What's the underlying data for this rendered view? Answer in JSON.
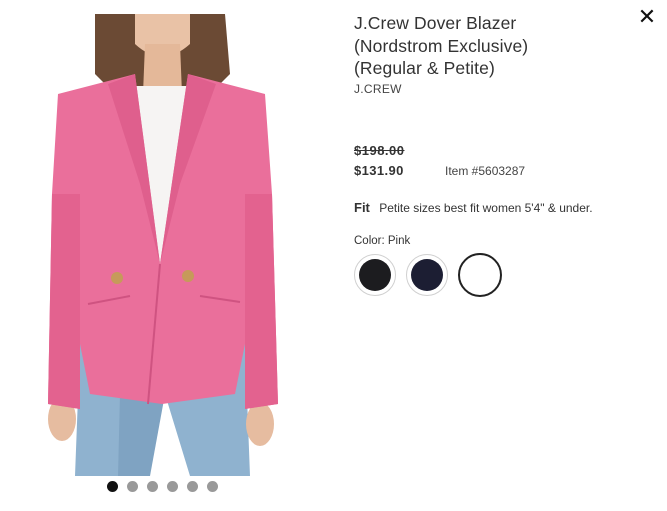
{
  "product": {
    "title_line1": "J.Crew Dover Blazer",
    "title_line2": "(Nordstrom Exclusive)",
    "title_line3": "(Regular & Petite)",
    "brand": "J.CREW",
    "original_price": "$198.00",
    "sale_price": "$131.90",
    "item_number": "Item #5603287",
    "fit_label": "Fit",
    "fit_text": "Petite sizes best fit women 5'4\" & under.",
    "color_label": "Color: Pink"
  },
  "swatches": [
    {
      "name": "black",
      "color": "#1c1c1f"
    },
    {
      "name": "navy",
      "color": "#1c1e33"
    },
    {
      "name": "white",
      "color": "#ffffff"
    }
  ],
  "gallery": {
    "image_count": 6,
    "active_index": 0,
    "blazer_color": "#ea6f9b"
  },
  "close_glyph": "✕"
}
